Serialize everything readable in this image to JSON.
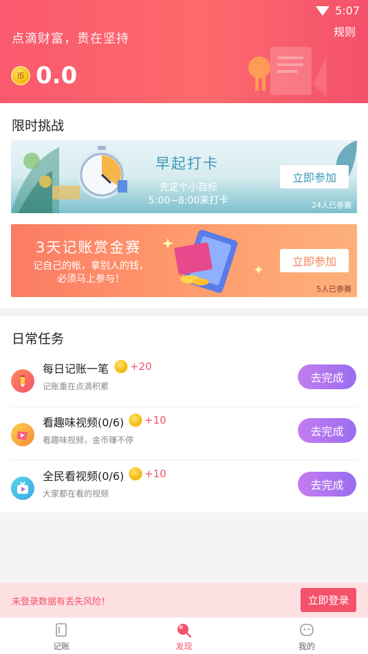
{
  "status_bar": {
    "time": "5:07"
  },
  "header": {
    "slogan": "点滴财富，贵在坚持",
    "rules_label": "规则",
    "coin_symbol": "币",
    "balance": "0.0"
  },
  "challenge": {
    "title": "限时挑战",
    "banners": [
      {
        "title": "早起打卡",
        "subtitle_line1": "先定个小目标",
        "subtitle_line2": "5:00~8:00来打卡",
        "join_label": "立即参加",
        "participants": "24人已参赛"
      },
      {
        "title": "3天记账赏金赛",
        "subtitle_line1": "记自己的帐，拿别人的钱，",
        "subtitle_line2": "必须马上参与！",
        "join_label": "立即参加",
        "participants": "5人已参赛"
      }
    ]
  },
  "daily": {
    "title": "日常任务",
    "tasks": [
      {
        "name": "每日记账一笔",
        "reward": "+20",
        "desc": "记账重在点滴积累",
        "button": "去完成"
      },
      {
        "name": "看趣味视频(0/6)",
        "reward": "+10",
        "desc": "看趣味视频，金币赚不停",
        "button": "去完成"
      },
      {
        "name": "全民看视频(0/6)",
        "reward": "+10",
        "desc": "大家都在看的视频",
        "button": "去完成"
      }
    ]
  },
  "login_bar": {
    "text": "未登录数据有丢失风险！",
    "button": "立即登录"
  },
  "nav": {
    "items": [
      {
        "label": "记账"
      },
      {
        "label": "发现"
      },
      {
        "label": "我的"
      }
    ],
    "active": "发现"
  },
  "colors": {
    "accent": "#f4516b",
    "purple": "#a56ef0",
    "header_bg": "#fd6a6c"
  }
}
